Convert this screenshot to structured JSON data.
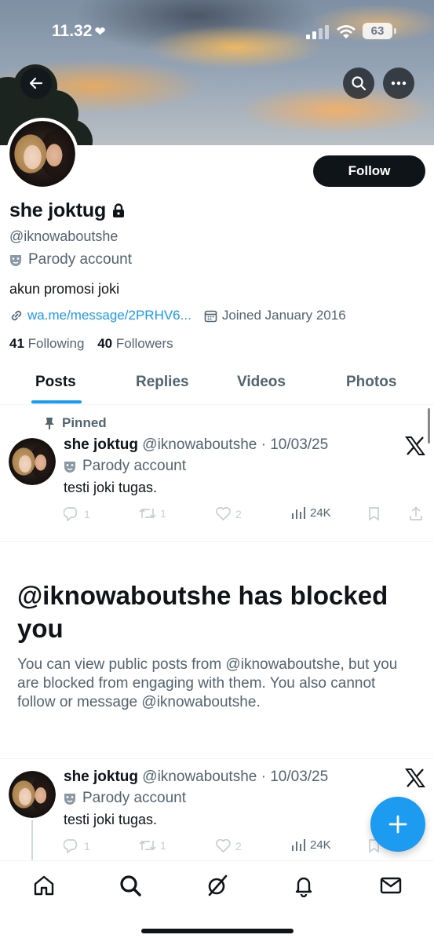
{
  "status_bar": {
    "time": "11.32",
    "battery": "63"
  },
  "profile": {
    "name": "she joktug",
    "handle": "@iknowaboutshe",
    "parody_label": "Parody account",
    "bio": "akun promosi joki",
    "link": "wa.me/message/2PRHV6...",
    "joined": "Joined January 2016",
    "following_count": "41",
    "following_label": "Following",
    "followers_count": "40",
    "followers_label": "Followers",
    "follow_button": "Follow"
  },
  "tabs": [
    {
      "label": "Posts"
    },
    {
      "label": "Replies"
    },
    {
      "label": "Videos"
    },
    {
      "label": "Photos"
    }
  ],
  "pinned_label": "Pinned",
  "posts": [
    {
      "name": "she joktug",
      "handle_date": "@iknowaboutshe · 10/03/25",
      "parody_label": "Parody account",
      "text": "testi joki tugas.",
      "replies": "1",
      "reposts": "1",
      "likes": "2",
      "views": "24K"
    },
    {
      "name": "she joktug",
      "handle_date": "@iknowaboutshe · 10/03/25",
      "parody_label": "Parody account",
      "text": "testi joki tugas.",
      "replies": "1",
      "reposts": "1",
      "likes": "2",
      "views": "24K"
    }
  ],
  "blocked": {
    "title": "@iknowaboutshe has blocked you",
    "text": "You can view public posts from @iknowaboutshe, but you are blocked from engaging with them. You also cannot follow or message @iknowaboutshe."
  },
  "colors": {
    "accent": "#1d9bf0",
    "text": "#0f1419",
    "muted": "#536471"
  }
}
